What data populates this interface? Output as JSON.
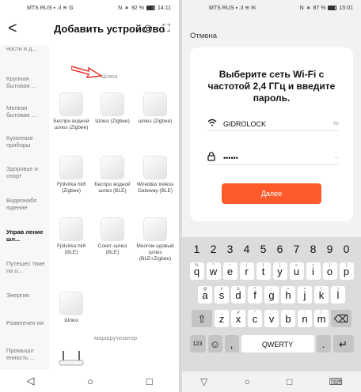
{
  "left": {
    "status": {
      "carrier": "MTS RUS",
      "net": "G",
      "battery_text": "92 %",
      "battery_level": 0.92,
      "time": "14:11"
    },
    "header": {
      "back": "<",
      "title": "Добавить устройство"
    },
    "sidebar": [
      {
        "label": "ности и д...",
        "active": false
      },
      {
        "label": "Крупная бытовая ...",
        "active": false
      },
      {
        "label": "Мелкая бытовая ...",
        "active": false
      },
      {
        "label": "Кухонные приборы",
        "active": false
      },
      {
        "label": "Здоровье и спорт",
        "active": false
      },
      {
        "label": "Видеонабл юдение",
        "active": false
      },
      {
        "label": "Управ ление шл...",
        "active": true
      },
      {
        "label": "Путешес твие на о...",
        "active": false
      },
      {
        "label": "Энергия",
        "active": false
      },
      {
        "label": "Развлечен ия",
        "active": false
      },
      {
        "label": "Промышл енность ...",
        "active": false
      }
    ],
    "section_gateway": "Шлюз",
    "devices": [
      {
        "label": "Беспро водной шлюз (Zigbee)"
      },
      {
        "label": "Шлюз (Zigbee)"
      },
      {
        "label": "шлюз (Zigbee)"
      },
      {
        "label": "Fjölvirka hlið (Zigbee)"
      },
      {
        "label": "Беспро водной шлюз (BLE)"
      },
      {
        "label": "Wired&w ireless Gateway (BLE)"
      },
      {
        "label": "Fjölvirka hlið (BLE)"
      },
      {
        "label": "Сокет-шлюз (BLE)"
      },
      {
        "label": "Многом одовый шлюз (BLE+Zigbee)"
      },
      {
        "label": "Шлюз"
      }
    ],
    "section_router": "маршрутизатор"
  },
  "right": {
    "status": {
      "carrier": "MTS RUS",
      "battery_text": "87 %",
      "battery_level": 0.87,
      "time": "15:01"
    },
    "cancel": "Отмена",
    "title": "Выберите сеть Wi-Fi с частотой 2,4 ГГц и введите пароль.",
    "ssid": "GIDROLOCK",
    "password": "••••••",
    "next_button": "Далее",
    "keyboard": {
      "numbers": [
        "1",
        "2",
        "3",
        "4",
        "5",
        "6",
        "7",
        "8",
        "9",
        "0"
      ],
      "row1": [
        [
          "q",
          "%"
        ],
        [
          "w",
          "^"
        ],
        [
          "e",
          "~"
        ],
        [
          "r",
          "|"
        ],
        [
          "t",
          "["
        ],
        [
          "y",
          "]"
        ],
        [
          "u",
          "<"
        ],
        [
          "i",
          ">"
        ],
        [
          "o",
          "{"
        ],
        [
          "p",
          "}"
        ]
      ],
      "row2": [
        [
          "a",
          "@"
        ],
        [
          "s",
          "#"
        ],
        [
          "d",
          "&"
        ],
        [
          "f",
          "*"
        ],
        [
          "g",
          "-"
        ],
        [
          "h",
          "+"
        ],
        [
          "j",
          "="
        ],
        [
          "k",
          "("
        ],
        [
          "l",
          ")"
        ]
      ],
      "row3": [
        [
          "z",
          "_"
        ],
        [
          "x",
          "₽"
        ],
        [
          "c",
          "\""
        ],
        [
          "v",
          "'"
        ],
        [
          "b",
          ":"
        ],
        [
          "n",
          ";"
        ],
        [
          "m",
          "/"
        ]
      ],
      "row4": {
        "num_key": "123",
        "space": "QWERTY",
        "dot": "."
      }
    }
  }
}
